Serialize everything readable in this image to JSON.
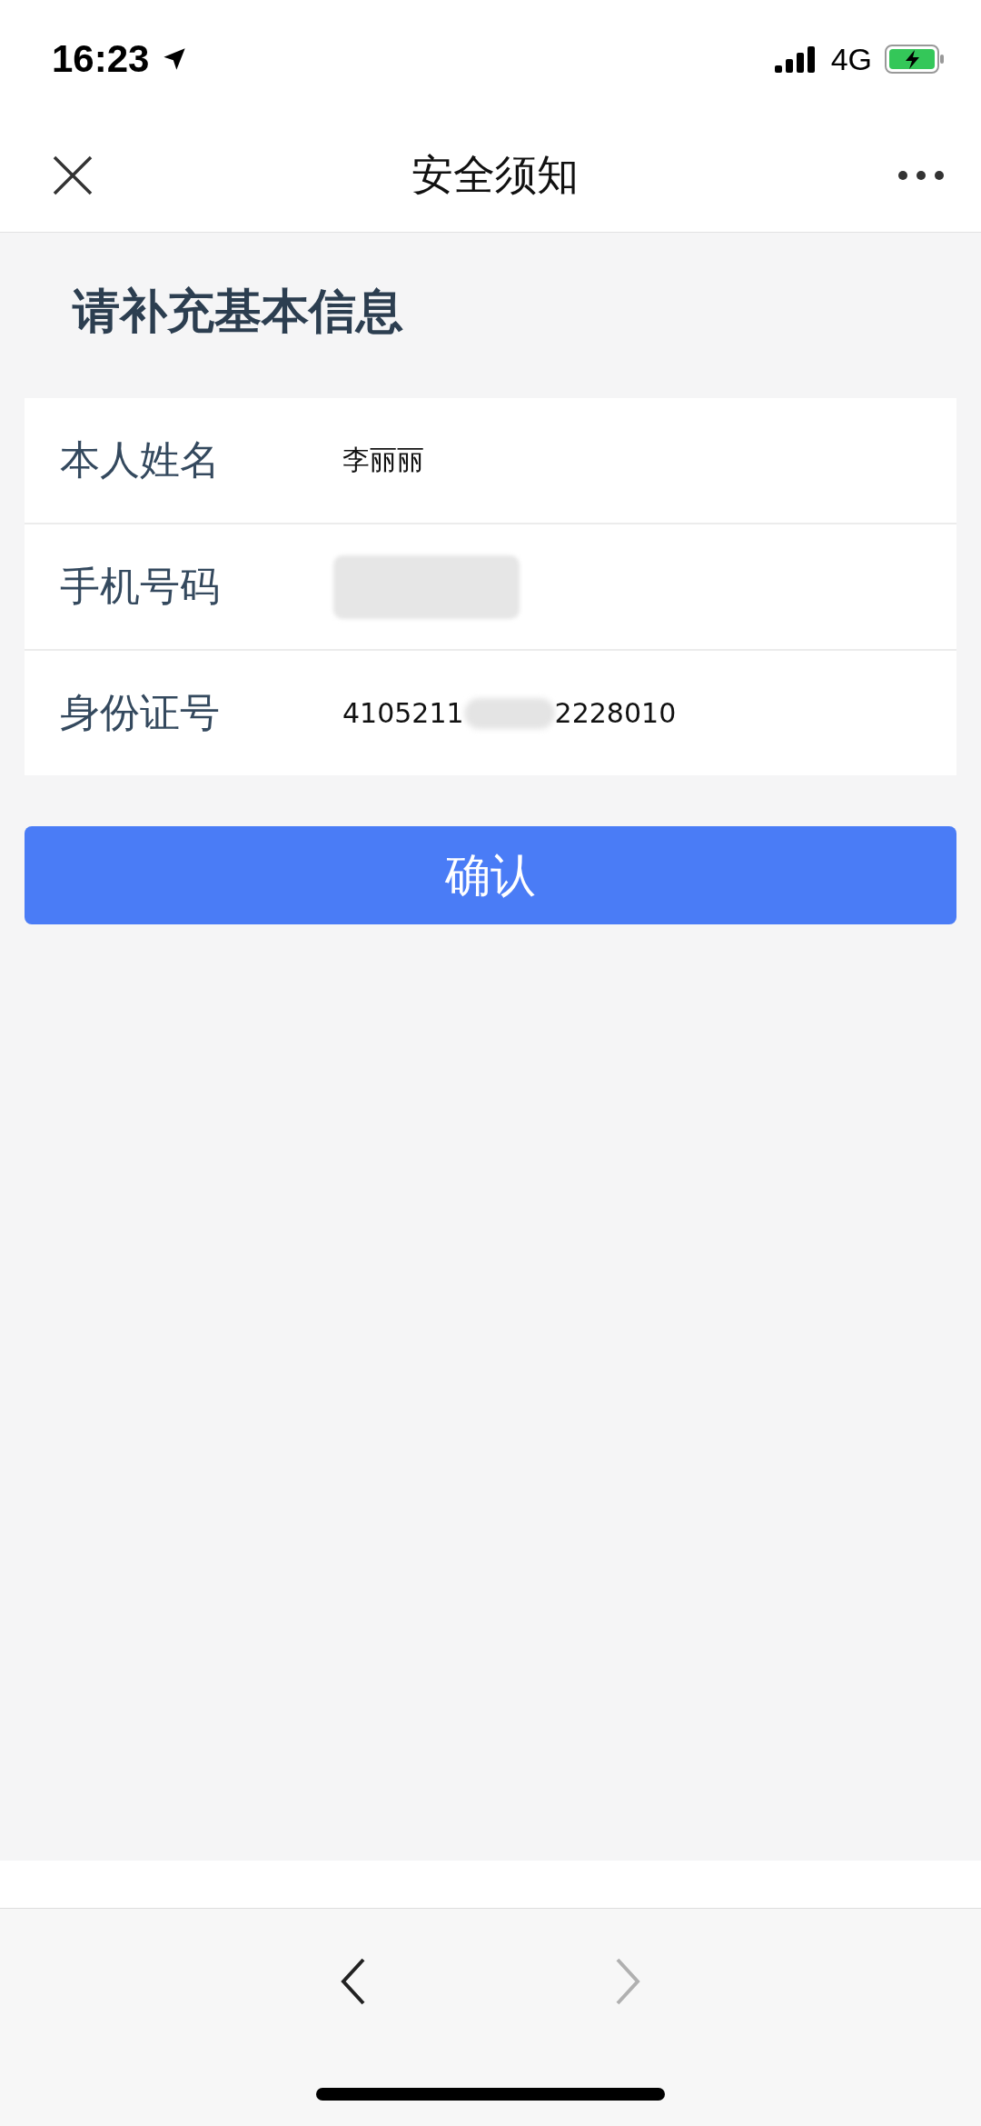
{
  "status_bar": {
    "time": "16:23",
    "network": "4G"
  },
  "nav_bar": {
    "title": "安全须知"
  },
  "form": {
    "heading": "请补充基本信息",
    "fields": [
      {
        "label": "本人姓名",
        "value": "李丽丽",
        "kind": "text"
      },
      {
        "label": "手机号码",
        "kind": "redacted"
      },
      {
        "label": "身份证号",
        "value_start": "4105211",
        "value_end": "2228010",
        "kind": "partly-redacted"
      }
    ],
    "submit": "确认"
  },
  "browser_bar": {
    "back_disabled": false,
    "forward_disabled": true
  }
}
